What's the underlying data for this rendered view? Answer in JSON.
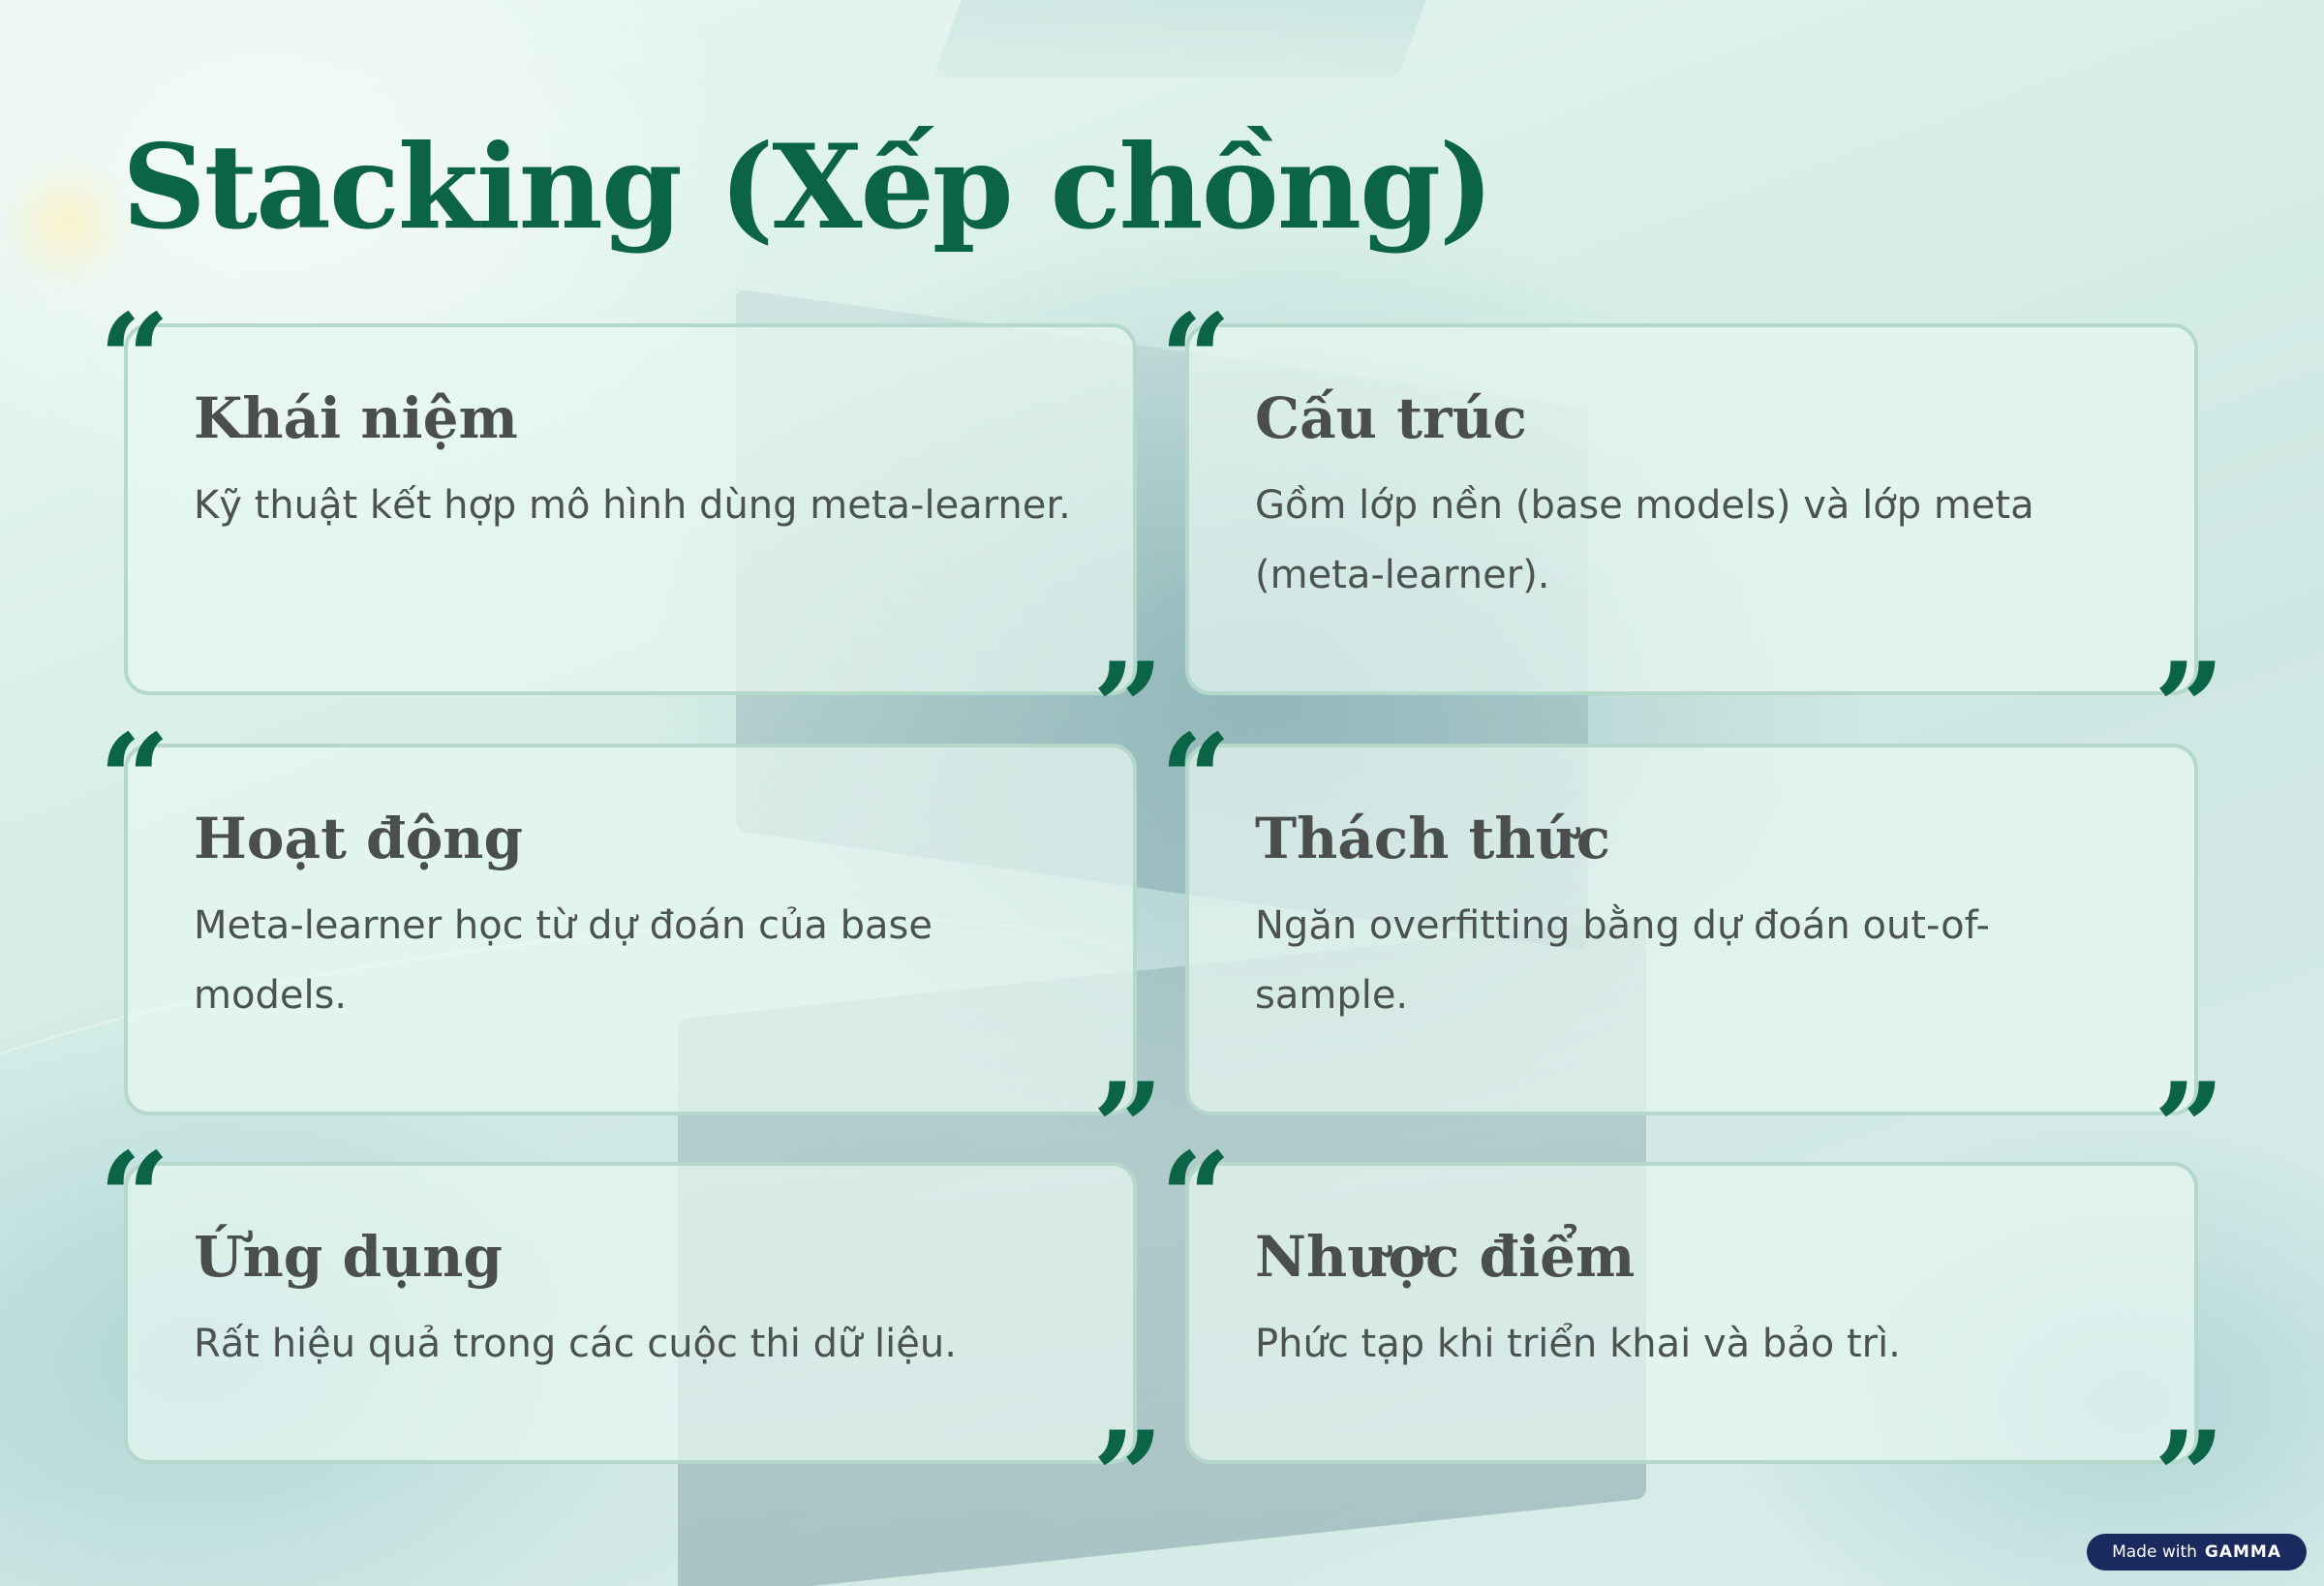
{
  "title": "Stacking (Xếp chồng)",
  "quote_marks": {
    "open": "“",
    "close": "”"
  },
  "cards": [
    {
      "heading": "Khái niệm",
      "text": "Kỹ thuật kết hợp mô hình dùng meta-learner."
    },
    {
      "heading": "Cấu trúc",
      "text": "Gồm lớp nền (base models) và lớp meta (meta-learner)."
    },
    {
      "heading": "Hoạt động",
      "text": "Meta-learner học từ dự đoán của base models."
    },
    {
      "heading": "Thách thức",
      "text": "Ngăn overfitting bằng dự đoán out-of-sample."
    },
    {
      "heading": "Ứng dụng",
      "text": "Rất hiệu quả trong các cuộc thi dữ liệu."
    },
    {
      "heading": "Nhược điểm",
      "text": "Phức tạp khi triển khai và bảo trì."
    }
  ],
  "badge": {
    "prefix": "Made with",
    "brand": "GAMMA"
  },
  "colors": {
    "accent": "#0b6446",
    "card_border": "#b4d8ca",
    "text": "#4c5250",
    "badge_bg": "#1b2a5e"
  }
}
